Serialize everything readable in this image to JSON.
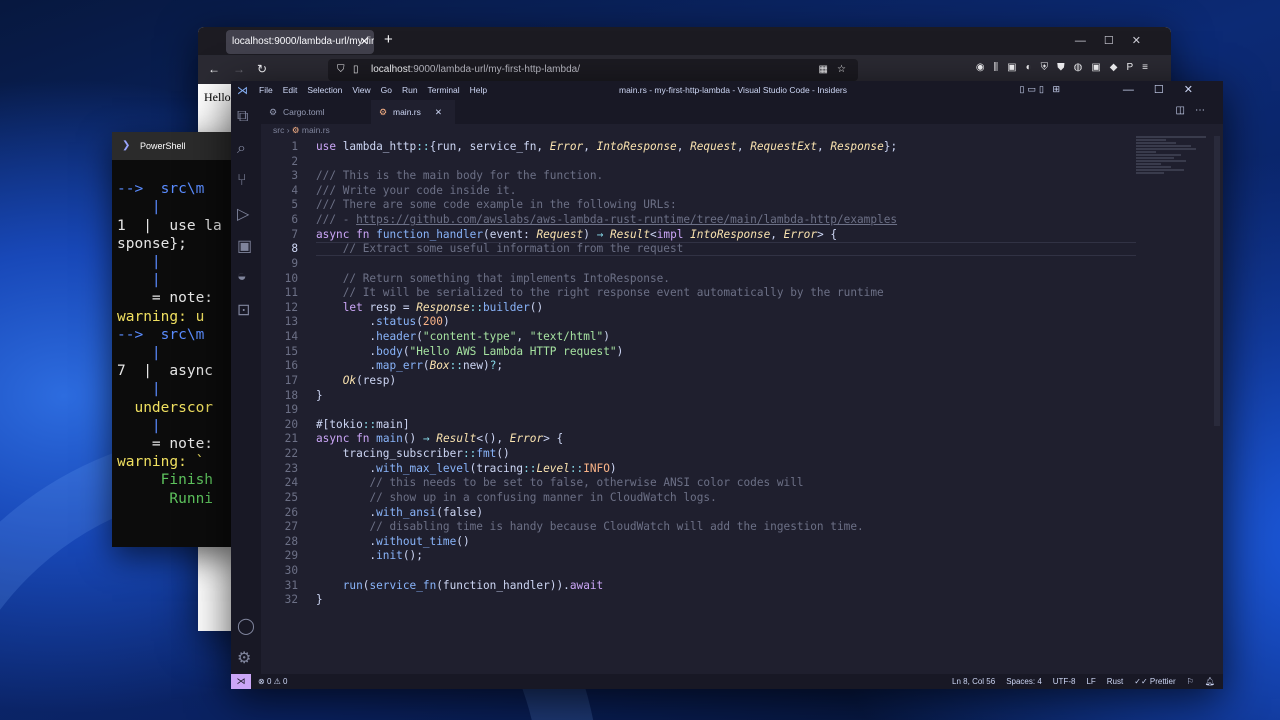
{
  "firefox": {
    "tab_title": "localhost:9000/lambda-url/my-first",
    "url_host": "localhost",
    "url_rest": ":9000/lambda-url/my-first-http-lambda/",
    "page_text": "Hello"
  },
  "powershell": {
    "title": "PowerShell",
    "lines": [
      "-->  src\\m",
      "    |",
      "1  |  use la",
      "sponse};",
      "    |",
      "    |",
      "    = note:",
      "",
      "warning: u",
      "-->  src\\m",
      "    |",
      "7  |  async",
      "    |",
      "  underscor",
      "    |",
      "    = note:",
      "",
      "warning: `",
      "     Finish",
      "      Runni"
    ]
  },
  "vscode": {
    "menu": [
      "File",
      "Edit",
      "Selection",
      "View",
      "Go",
      "Run",
      "Terminal",
      "Help"
    ],
    "window_title": "main.rs - my-first-http-lambda - Visual Studio Code - Insiders",
    "tabs": [
      {
        "label": "Cargo.toml"
      },
      {
        "label": "main.rs"
      }
    ],
    "breadcrumb": [
      "src",
      "main.rs"
    ],
    "status": {
      "errors": "0",
      "warnings": "0",
      "position": "Ln 8, Col 56",
      "spaces": "Spaces: 4",
      "encoding": "UTF-8",
      "eol": "LF",
      "language": "Rust",
      "formatter": "Prettier"
    },
    "code_lines": [
      "use lambda_http::{run, service_fn, Error, IntoResponse, Request, RequestExt, Response};",
      "",
      "/// This is the main body for the function.",
      "/// Write your code inside it.",
      "/// There are some code example in the following URLs:",
      "/// - https://github.com/awslabs/aws-lambda-rust-runtime/tree/main/lambda-http/examples",
      "async fn function_handler(event: Request) → Result<impl IntoResponse, Error> {",
      "    // Extract some useful information from the request",
      "",
      "    // Return something that implements IntoResponse.",
      "    // It will be serialized to the right response event automatically by the runtime",
      "    let resp = Response::builder()",
      "        .status(200)",
      "        .header(\"content-type\", \"text/html\")",
      "        .body(\"Hello AWS Lambda HTTP request\")",
      "        .map_err(Box::new)?;",
      "    Ok(resp)",
      "}",
      "",
      "#[tokio::main]",
      "async fn main() → Result<(), Error> {",
      "    tracing_subscriber::fmt()",
      "        .with_max_level(tracing::Level::INFO)",
      "        // this needs to be set to false, otherwise ANSI color codes will",
      "        // show up in a confusing manner in CloudWatch logs.",
      "        .with_ansi(false)",
      "        // disabling time is handy because CloudWatch will add the ingestion time.",
      "        .without_time()",
      "        .init();",
      "",
      "    run(service_fn(function_handler)).await",
      "}"
    ]
  }
}
